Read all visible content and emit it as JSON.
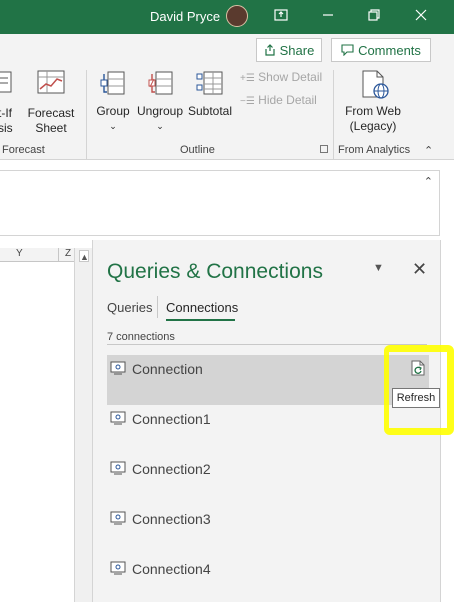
{
  "titlebar": {
    "user_name": "David Pryce",
    "bg_color": "#217346"
  },
  "ribbon": {
    "share_label": "Share",
    "comments_label": "Comments",
    "whatif_label_1": "t-If",
    "whatif_label_2": "sis",
    "forecast_sheet_label_1": "Forecast",
    "forecast_sheet_label_2": "Sheet",
    "group_label": "Group",
    "ungroup_label": "Ungroup",
    "subtotal_label": "Subtotal",
    "show_detail_label": "Show Detail",
    "hide_detail_label": "Hide Detail",
    "from_web_label_1": "From Web",
    "from_web_label_2": "(Legacy)",
    "groups": {
      "forecast": "Forecast",
      "outline": "Outline",
      "from_analytics": "From Analytics"
    }
  },
  "grid": {
    "col_y": "Y",
    "col_z": "Z"
  },
  "pane": {
    "title": "Queries & Connections",
    "tabs": [
      {
        "label": "Queries"
      },
      {
        "label": "Connections"
      }
    ],
    "count_label": "7 connections",
    "connections": [
      {
        "name": "Connection"
      },
      {
        "name": "Connection1"
      },
      {
        "name": "Connection2"
      },
      {
        "name": "Connection3"
      },
      {
        "name": "Connection4"
      }
    ],
    "tooltip": "Refresh",
    "accent_color": "#217346",
    "highlight_color": "#ffff00"
  }
}
